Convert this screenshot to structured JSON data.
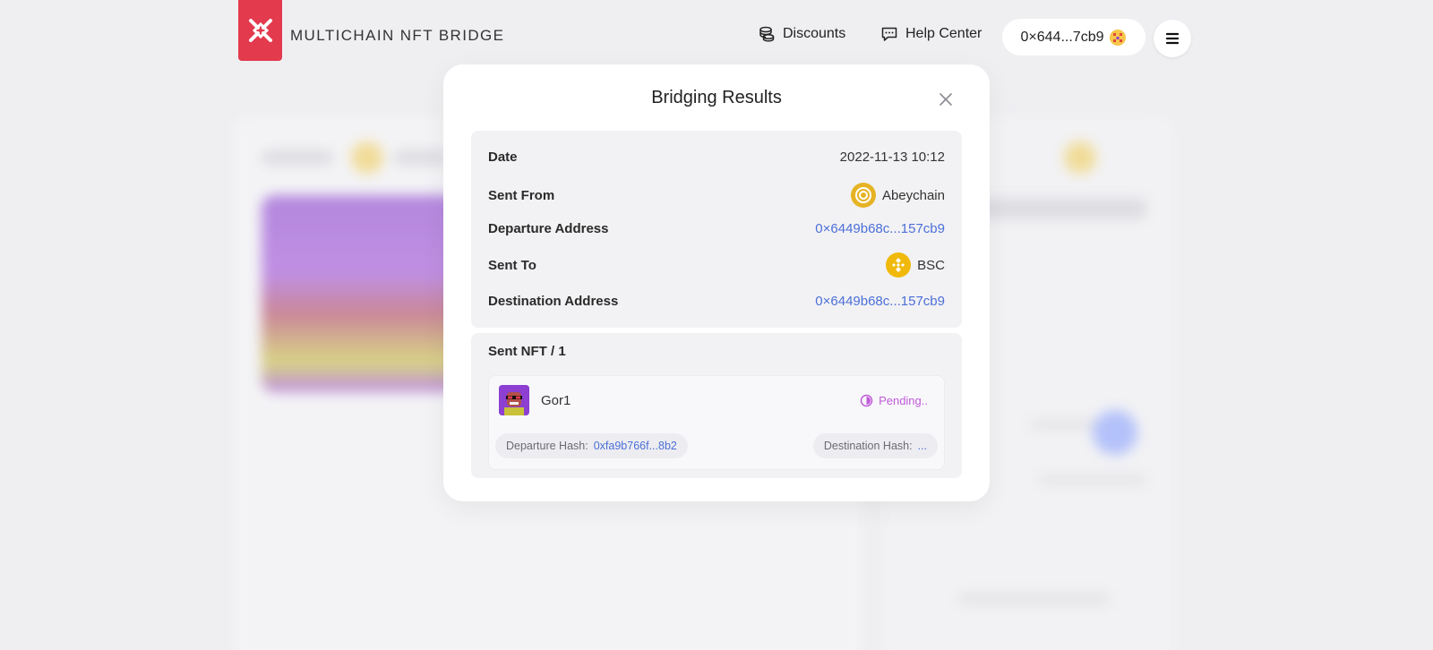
{
  "header": {
    "brand": "MULTICHAIN NFT BRIDGE",
    "nav": {
      "discounts": "Discounts",
      "help_center": "Help Center"
    },
    "wallet": {
      "address": "0×644...7cb9"
    }
  },
  "modal": {
    "title": "Bridging Results",
    "info": {
      "date_label": "Date",
      "date_value": "2022-11-13 10:12",
      "sent_from_label": "Sent From",
      "sent_from_value": "Abeychain",
      "departure_label": "Departure Address",
      "departure_value": "0×6449b68c...157cb9",
      "sent_to_label": "Sent To",
      "sent_to_value": "BSC",
      "destination_label": "Destination Address",
      "destination_value": "0×6449b68c...157cb9"
    },
    "nfts": {
      "title": "Sent NFT / 1",
      "items": [
        {
          "name": "Gor1",
          "status": "Pending..",
          "departure_hash_label": "Departure Hash:",
          "departure_hash_value": "0xfa9b766f...8b2",
          "destination_hash_label": "Destination Hash:",
          "destination_hash_value": "..."
        }
      ]
    }
  },
  "colors": {
    "brand_red": "#e33a4e",
    "link_blue": "#4c6fd8",
    "pending_purple": "#c05bd8",
    "bsc_yellow": "#f0b90b",
    "abey_gold": "#e6b325"
  }
}
